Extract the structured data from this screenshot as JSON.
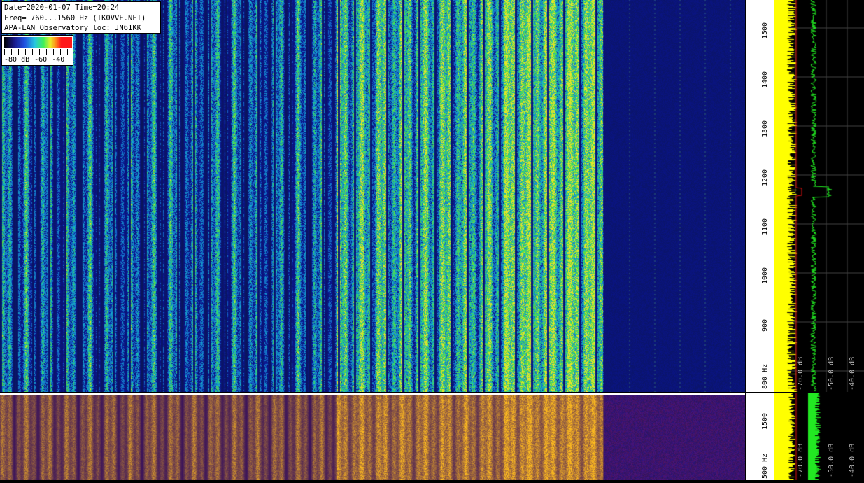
{
  "info": {
    "line1": "Date=2020-01-07 Time=20:24",
    "line2": "Freq= 760...1560 Hz (IK0VVE.NET)",
    "line3": "APA-LAN Observatory loc: JN61KK"
  },
  "legend": {
    "labels": [
      "-80 dB",
      "-60",
      "-40"
    ]
  },
  "axis": {
    "ticks": [
      "1500",
      "1400",
      "1300",
      "1200",
      "1100",
      "1000",
      "900",
      "800 Hz"
    ],
    "lower_ticks": [
      "1500",
      "500 Hz"
    ]
  },
  "spectrum": {
    "db_labels": [
      "-70.0 dB",
      "-50.0 dB",
      "-40.0 dB"
    ]
  },
  "colors": {
    "trace_yellow": "#ffff00",
    "trace_green": "#22e822",
    "trace_red": "#e01010"
  }
}
